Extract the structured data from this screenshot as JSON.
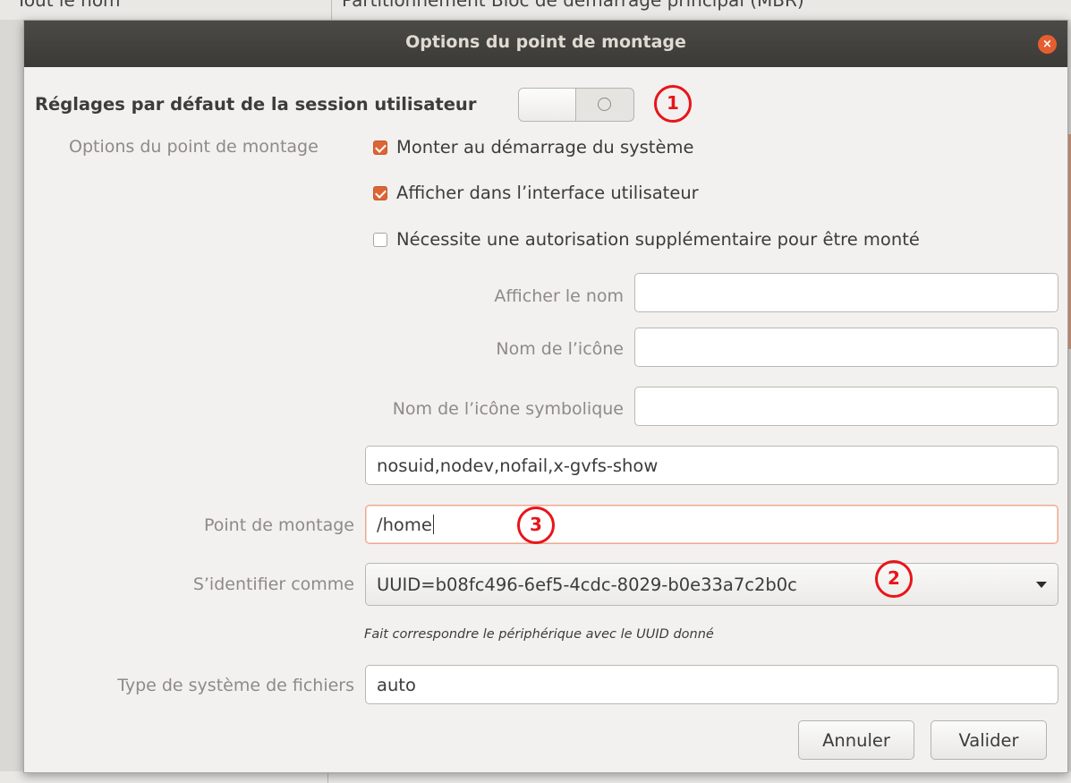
{
  "background": {
    "left_text": "Tout le nom",
    "top_text": "Partitionnement   Bloc de démarrage principal (MBR)"
  },
  "dialog": {
    "title": "Options du point de montage",
    "session_defaults_label": "Réglages par défaut de la session utilisateur",
    "session_defaults_on": false,
    "mount_options_label": "Options du point de montage",
    "checkboxes": [
      {
        "label": "Monter au démarrage du système",
        "checked": true
      },
      {
        "label": "Afficher dans l’interface utilisateur",
        "checked": true
      },
      {
        "label": "Nécessite une autorisation supplémentaire pour être monté",
        "checked": false
      }
    ],
    "display_name_label": "Afficher le nom",
    "display_name_value": "",
    "icon_name_label": "Nom de l’icône",
    "icon_name_value": "",
    "symbolic_icon_label": "Nom de l’icône symbolique",
    "symbolic_icon_value": "",
    "options_value": "nosuid,nodev,nofail,x-gvfs-show",
    "mount_point_label": "Point de montage",
    "mount_point_value": "/home",
    "identify_as_label": "S’identifier comme",
    "identify_as_value": "UUID=b08fc496-6ef5-4cdc-8029-b0e33a7c2b0c",
    "identify_hint": "Fait correspondre le périphérique avec le UUID donné",
    "fs_type_label": "Type de système de fichiers",
    "fs_type_value": "auto",
    "cancel_label": "Annuler",
    "ok_label": "Valider",
    "close_glyph": "×"
  },
  "annotations": {
    "marker_1": "1",
    "marker_2": "2",
    "marker_3": "3",
    "color": "#e8151a"
  },
  "colors": {
    "accent": "#dc6536",
    "titlebar": "#3f3e3a"
  }
}
